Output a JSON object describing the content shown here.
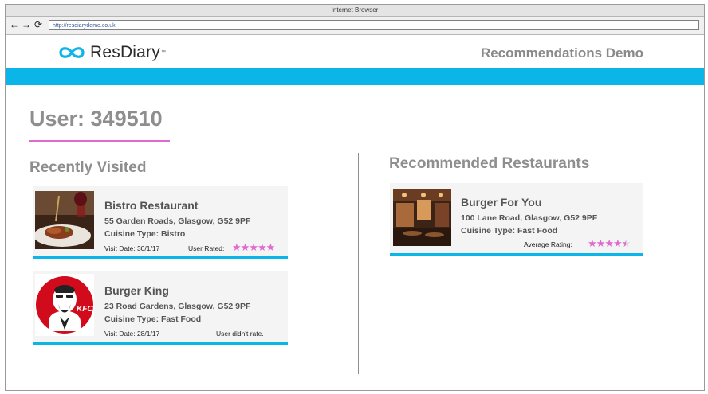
{
  "browser": {
    "title": "Internet Browser",
    "url": "http://resdiarydemo.co.uk",
    "back_icon": "←",
    "forward_icon": "→",
    "reload_icon": "⟳"
  },
  "header": {
    "logo_text": "ResDiary",
    "logo_tm": "™",
    "demo_title": "Recommendations Demo",
    "accent_color": "#0bb5e8"
  },
  "user": {
    "title": "User: 349510",
    "underline_color": "#e06ad0"
  },
  "recently_visited": {
    "title": "Recently Visited",
    "items": [
      {
        "name": "Bistro Restaurant",
        "address": "55 Garden Roads, Glasgow, G52 9PF",
        "cuisine": "Cuisine Type: Bistro",
        "visit_date": "Visit Date: 30/1/17",
        "rating_label": "User Rated:",
        "rating_stars": 5,
        "image": "bistro-food-photo"
      },
      {
        "name": "Burger King",
        "address": "23 Road Gardens, Glasgow, G52 9PF",
        "cuisine": "Cuisine Type: Fast Food",
        "visit_date": "Visit Date: 28/1/17",
        "rating_label": "User didn't rate.",
        "image": "kfc-logo"
      }
    ]
  },
  "recommended": {
    "title": "Recommended Restaurants",
    "items": [
      {
        "name": "Burger For You",
        "address": "100 Lane Road, Glasgow, G52 9PF",
        "cuisine": "Cuisine Type: Fast Food",
        "rating_label": "Average Rating:",
        "rating_stars": 4.5,
        "image": "restaurant-interior-photo"
      }
    ]
  },
  "kfc_logo_text": "KFC"
}
